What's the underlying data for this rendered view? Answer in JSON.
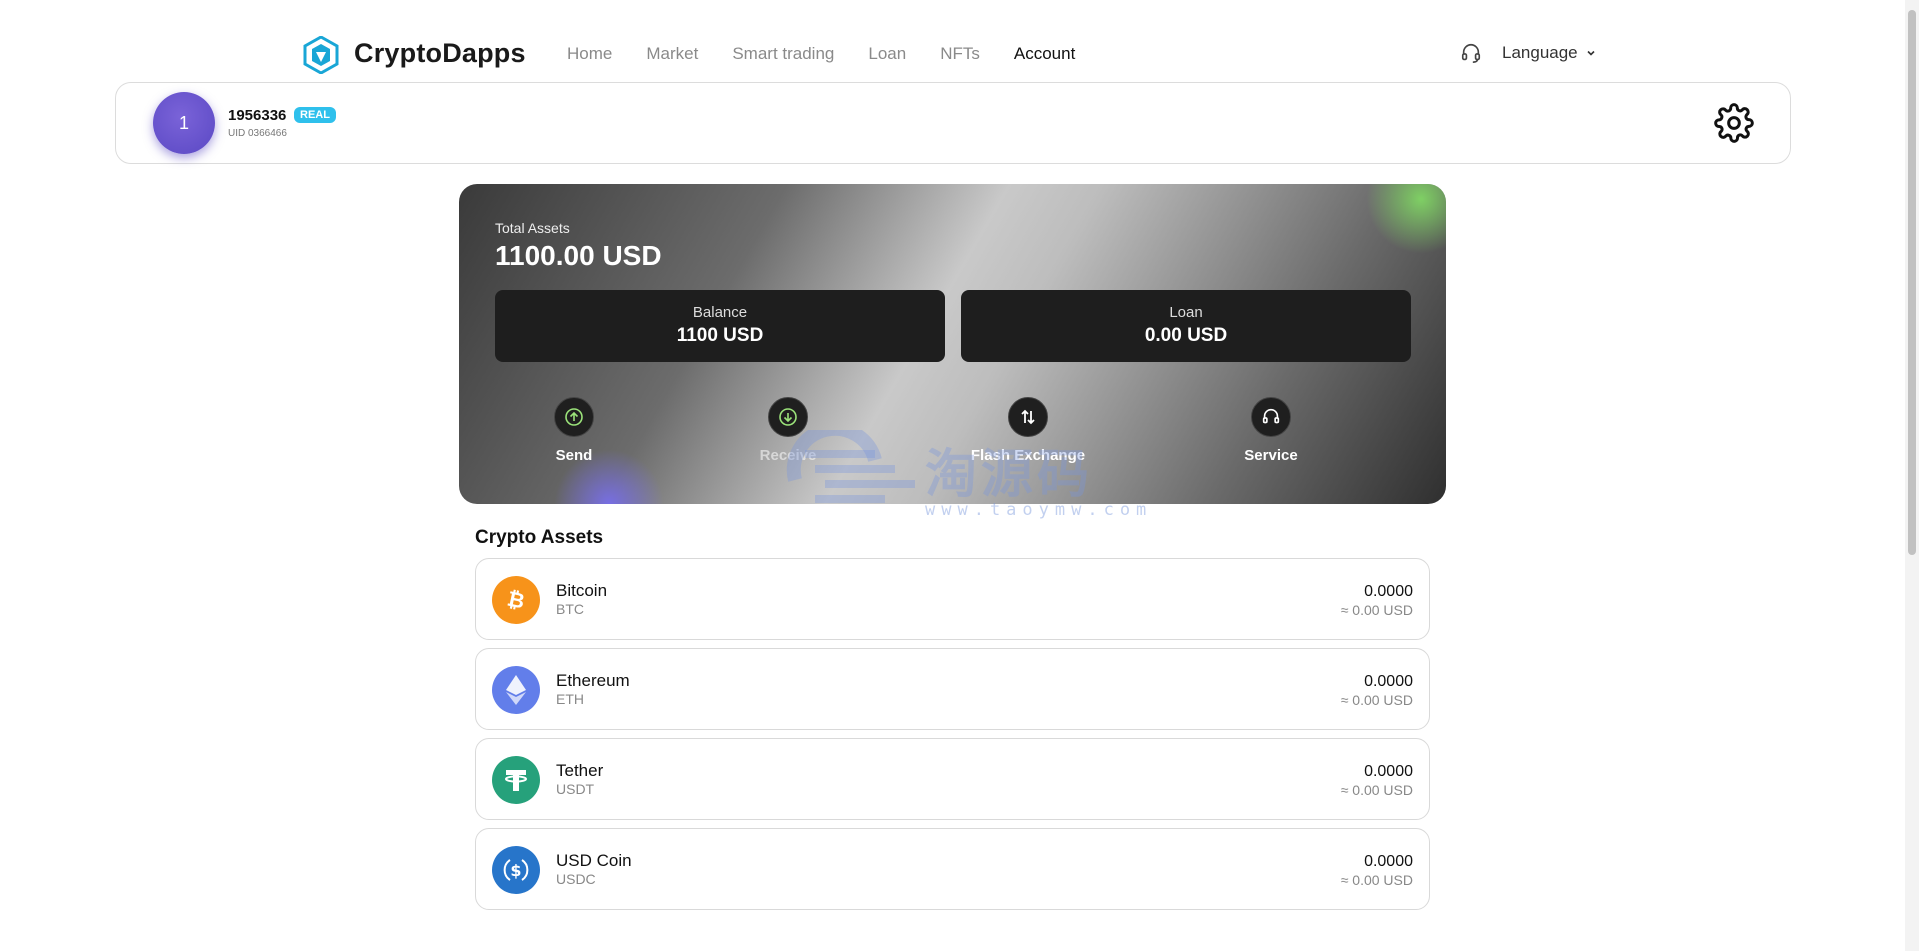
{
  "header": {
    "brand": "CryptoDapps",
    "nav": [
      "Home",
      "Market",
      "Smart trading",
      "Loan",
      "NFTs",
      "Account"
    ],
    "active_nav": "Account",
    "language_label": "Language"
  },
  "profile": {
    "avatar_initial": "1",
    "username": "1956336",
    "badge": "REAL",
    "uid": "UID 0366466"
  },
  "assets_card": {
    "total_label": "Total Assets",
    "total_value": "1100.00 USD",
    "balance_label": "Balance",
    "balance_value": "1100 USD",
    "loan_label": "Loan",
    "loan_value": "0.00 USD",
    "actions": [
      "Send",
      "Receive",
      "Flash Exchange",
      "Service"
    ]
  },
  "crypto": {
    "title": "Crypto Assets",
    "items": [
      {
        "name": "Bitcoin",
        "symbol": "BTC",
        "amount": "0.0000",
        "usd": "≈ 0.00 USD",
        "color": "#f7931a",
        "icon": "bitcoin-icon"
      },
      {
        "name": "Ethereum",
        "symbol": "ETH",
        "amount": "0.0000",
        "usd": "≈ 0.00 USD",
        "color": "#627eea",
        "icon": "ethereum-icon"
      },
      {
        "name": "Tether",
        "symbol": "USDT",
        "amount": "0.0000",
        "usd": "≈ 0.00 USD",
        "color": "#26a17b",
        "icon": "tether-icon"
      },
      {
        "name": "USD Coin",
        "symbol": "USDC",
        "amount": "0.0000",
        "usd": "≈ 0.00 USD",
        "color": "#2775ca",
        "icon": "usdc-icon"
      }
    ]
  },
  "watermark": {
    "text": "淘源码",
    "url": "www.taoymw.com"
  }
}
